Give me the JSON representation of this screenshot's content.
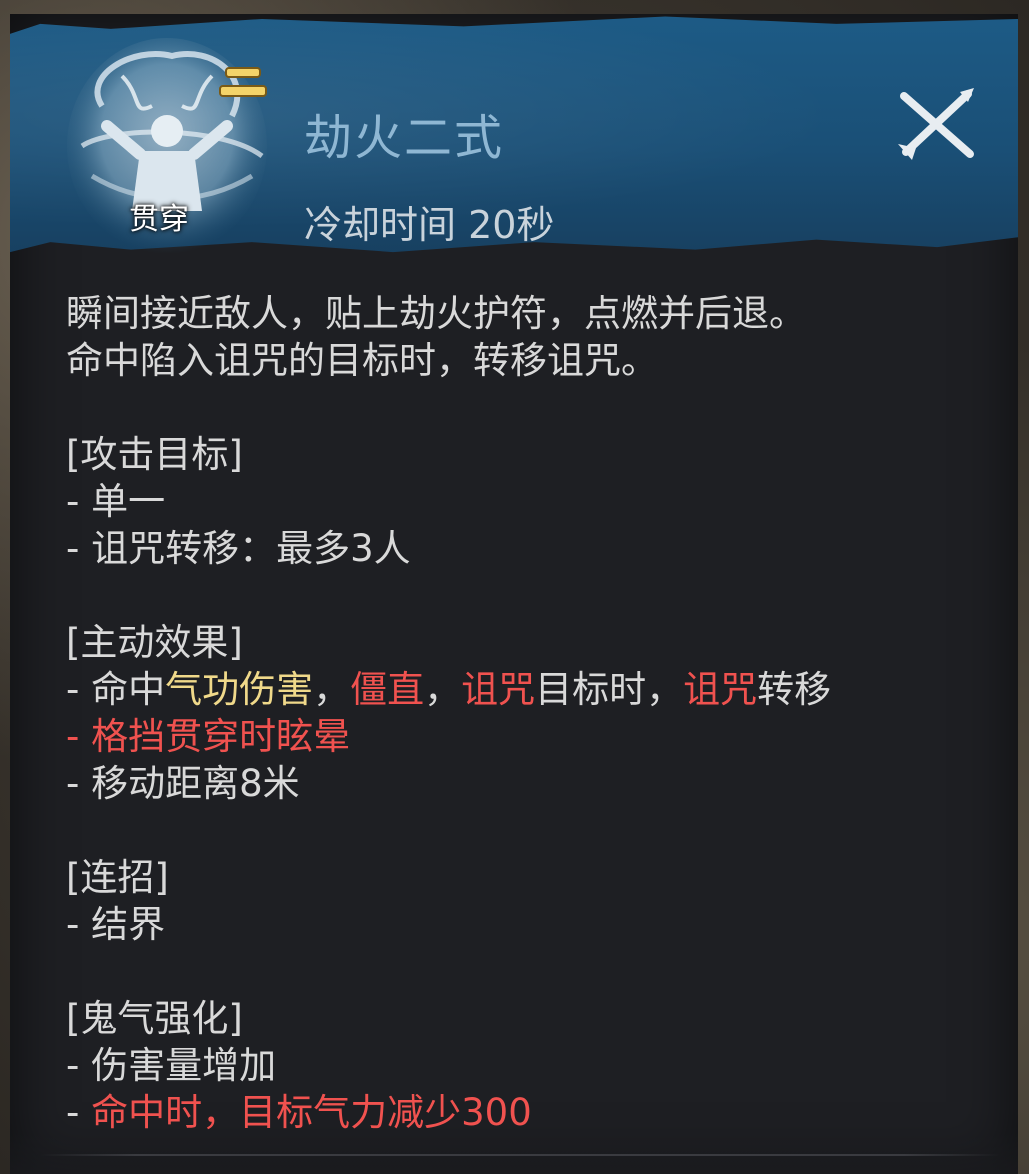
{
  "skill": {
    "name": "劫火二式",
    "cooldown": "冷却时间 20秒",
    "tag": "贯穿",
    "icon": "flame-warrior-icon",
    "tier_icon": "rank-two-icon"
  },
  "close_icon": "close-icon",
  "description": {
    "line1": "瞬间接近敌人，贴上劫火护符，点燃并后退。",
    "line2": "命中陷入诅咒的目标时，转移诅咒。"
  },
  "sections": {
    "targets": {
      "header": "[攻击目标]",
      "item1": "- 单一",
      "item2": "- 诅咒转移：最多3人"
    },
    "active": {
      "header": "[主动效果]",
      "r1_prefix": "- 命中",
      "r1_qigong": "气功伤害",
      "r1_sep1": "，",
      "r1_stiff": "僵直",
      "r1_sep2": "，",
      "r1_curse": "诅咒",
      "r1_mid": "目标时，",
      "r1_curse2": "诅咒",
      "r1_suffix": "转移",
      "r2_prefix": "- ",
      "r2_text": "格挡贯穿时眩晕",
      "r3": "- 移动距离8米"
    },
    "combo": {
      "header": "[连招]",
      "item1": "- 结界"
    },
    "ghost": {
      "header": "[鬼气强化]",
      "item1": "- 伤害量增加",
      "item2_prefix": "- ",
      "item2_text": "命中时，目标气力减少300"
    }
  },
  "colors": {
    "header_bg": "#1d5b86",
    "title": "#8fb7d3",
    "highlight_yellow": "#f0d98a",
    "highlight_red": "#f0524f",
    "text": "#d9d9d9"
  }
}
